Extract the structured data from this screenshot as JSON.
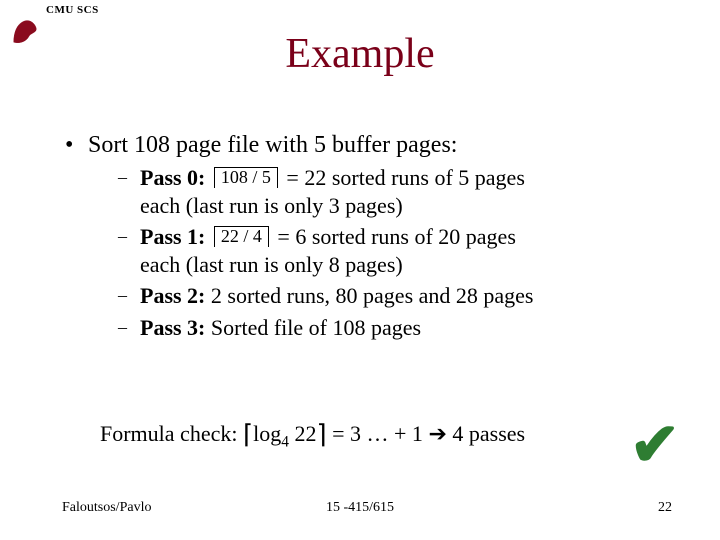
{
  "header": {
    "org": "CMU SCS"
  },
  "title": "Example",
  "main_bullet": "Sort 108 page file with 5 buffer pages:",
  "passes": [
    {
      "label": "Pass 0:",
      "ceil": "108 / 5",
      "rest1": " = 22 sorted runs of 5 pages",
      "rest2": "each (last run is only 3 pages)"
    },
    {
      "label": "Pass 1:",
      "ceil": "22 / 4",
      "rest1": " = 6 sorted runs of 20 pages",
      "rest2": "each (last run is only 8 pages)"
    },
    {
      "label": "Pass 2:",
      "rest1": "2 sorted runs, 80 pages and 28 pages"
    },
    {
      "label": "Pass 3:",
      "rest1": "Sorted file of 108 pages"
    }
  ],
  "formula": {
    "prefix": "Formula check: ",
    "lbr": "⌈",
    "logword": "log",
    "logbase": "4",
    "logarg": " 22",
    "rbr": "⌉",
    "mid": " = 3 … + 1 ",
    "arrow": "➔",
    "end": " 4 passes"
  },
  "checkmark": "✔",
  "footer": {
    "left": "Faloutsos/Pavlo",
    "center": "15 -415/615",
    "right": "22"
  }
}
